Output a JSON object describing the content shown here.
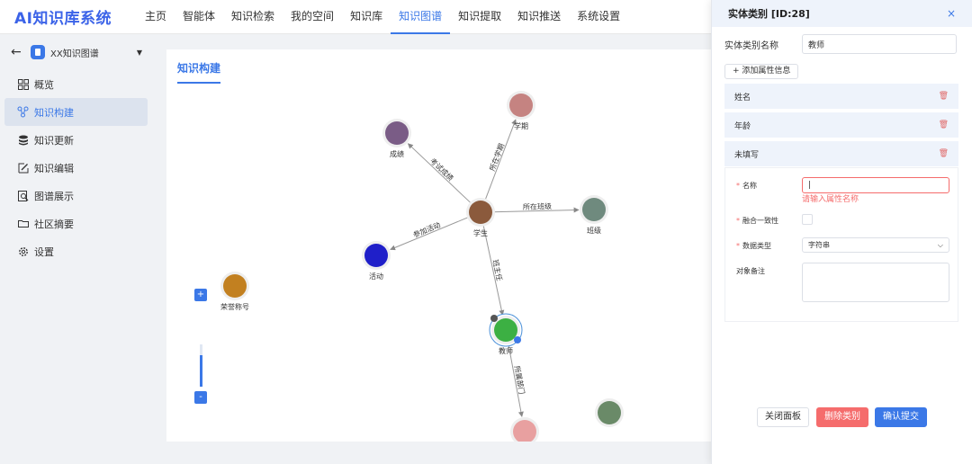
{
  "app": {
    "logo": "AI知识库系统"
  },
  "nav": {
    "items": [
      {
        "label": "主页"
      },
      {
        "label": "智能体"
      },
      {
        "label": "知识检索"
      },
      {
        "label": "我的空间"
      },
      {
        "label": "知识库"
      },
      {
        "label": "知识图谱"
      },
      {
        "label": "知识提取"
      },
      {
        "label": "知识推送"
      },
      {
        "label": "系统设置"
      }
    ],
    "active": "知识图谱"
  },
  "sidebar": {
    "graph_name": "XX知识图谱",
    "items": [
      {
        "label": "概览",
        "icon": "grid-icon"
      },
      {
        "label": "知识构建",
        "icon": "graph-nodes-icon"
      },
      {
        "label": "知识更新",
        "icon": "database-icon"
      },
      {
        "label": "知识编辑",
        "icon": "edit-icon"
      },
      {
        "label": "图谱展示",
        "icon": "search-doc-icon"
      },
      {
        "label": "社区摘要",
        "icon": "folder-icon"
      },
      {
        "label": "设置",
        "icon": "gear-icon"
      }
    ],
    "active": "知识构建"
  },
  "main": {
    "tab": "知识构建",
    "zoom_in": "+",
    "zoom_out": "-",
    "zoom_level": 0.75
  },
  "graph": {
    "nodes": [
      {
        "id": "student",
        "label": "学生",
        "color": "#8b5a3c"
      },
      {
        "id": "score",
        "label": "成绩",
        "color": "#7a5c86"
      },
      {
        "id": "term",
        "label": "学期",
        "color": "#c58381"
      },
      {
        "id": "class",
        "label": "班级",
        "color": "#6f8a7e"
      },
      {
        "id": "activity",
        "label": "活动",
        "color": "#1f1fc9"
      },
      {
        "id": "honor",
        "label": "荣誉称号",
        "color": "#c28020"
      },
      {
        "id": "teacher",
        "label": "教师",
        "color": "#3cb043",
        "selected": true
      },
      {
        "id": "dept",
        "label": "",
        "color": "#e8a0a0"
      },
      {
        "id": "unnamed",
        "label": "",
        "color": "#6a8a68"
      }
    ],
    "edges": [
      {
        "from": "student",
        "to": "score",
        "label": "考试成绩"
      },
      {
        "from": "student",
        "to": "term",
        "label": "所在学期"
      },
      {
        "from": "student",
        "to": "class",
        "label": "所在班级"
      },
      {
        "from": "student",
        "to": "activity",
        "label": "参加活动"
      },
      {
        "from": "student",
        "to": "teacher",
        "label": "班主任"
      },
      {
        "from": "teacher",
        "to": "dept",
        "label": "所属部门"
      }
    ]
  },
  "panel": {
    "title": "实体类别 [ID:28]",
    "close": "×",
    "name_label": "实体类别名称",
    "name_value": "教师",
    "add_attr": "+ 添加属性信息",
    "attributes": [
      {
        "label": "姓名"
      },
      {
        "label": "年龄"
      },
      {
        "label": "未填写"
      }
    ],
    "form": {
      "name_label": "名称",
      "name_value": "|",
      "name_error": "请输入属性名称",
      "fusion_label": "融合一致性",
      "type_label": "数据类型",
      "type_value": "字符串",
      "remark_label": "对象备注"
    },
    "buttons": {
      "close": "关闭面板",
      "delete": "删除类别",
      "confirm": "确认提交"
    }
  }
}
